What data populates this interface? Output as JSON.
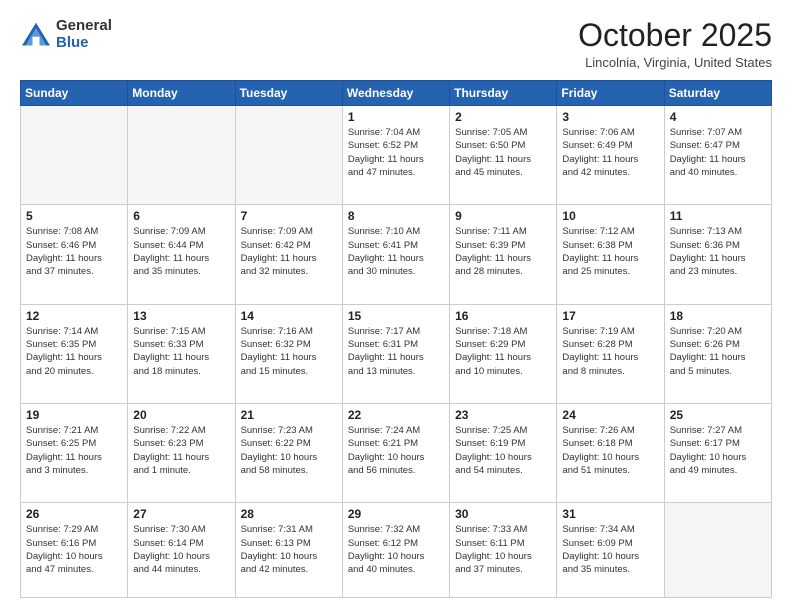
{
  "header": {
    "logo": {
      "general": "General",
      "blue": "Blue"
    },
    "title": "October 2025",
    "location": "Lincolnia, Virginia, United States"
  },
  "weekdays": [
    "Sunday",
    "Monday",
    "Tuesday",
    "Wednesday",
    "Thursday",
    "Friday",
    "Saturday"
  ],
  "weeks": [
    [
      {
        "day": "",
        "empty": true
      },
      {
        "day": "",
        "empty": true
      },
      {
        "day": "",
        "empty": true
      },
      {
        "day": "1",
        "info": "Sunrise: 7:04 AM\nSunset: 6:52 PM\nDaylight: 11 hours\nand 47 minutes."
      },
      {
        "day": "2",
        "info": "Sunrise: 7:05 AM\nSunset: 6:50 PM\nDaylight: 11 hours\nand 45 minutes."
      },
      {
        "day": "3",
        "info": "Sunrise: 7:06 AM\nSunset: 6:49 PM\nDaylight: 11 hours\nand 42 minutes."
      },
      {
        "day": "4",
        "info": "Sunrise: 7:07 AM\nSunset: 6:47 PM\nDaylight: 11 hours\nand 40 minutes."
      }
    ],
    [
      {
        "day": "5",
        "info": "Sunrise: 7:08 AM\nSunset: 6:46 PM\nDaylight: 11 hours\nand 37 minutes."
      },
      {
        "day": "6",
        "info": "Sunrise: 7:09 AM\nSunset: 6:44 PM\nDaylight: 11 hours\nand 35 minutes."
      },
      {
        "day": "7",
        "info": "Sunrise: 7:09 AM\nSunset: 6:42 PM\nDaylight: 11 hours\nand 32 minutes."
      },
      {
        "day": "8",
        "info": "Sunrise: 7:10 AM\nSunset: 6:41 PM\nDaylight: 11 hours\nand 30 minutes."
      },
      {
        "day": "9",
        "info": "Sunrise: 7:11 AM\nSunset: 6:39 PM\nDaylight: 11 hours\nand 28 minutes."
      },
      {
        "day": "10",
        "info": "Sunrise: 7:12 AM\nSunset: 6:38 PM\nDaylight: 11 hours\nand 25 minutes."
      },
      {
        "day": "11",
        "info": "Sunrise: 7:13 AM\nSunset: 6:36 PM\nDaylight: 11 hours\nand 23 minutes."
      }
    ],
    [
      {
        "day": "12",
        "info": "Sunrise: 7:14 AM\nSunset: 6:35 PM\nDaylight: 11 hours\nand 20 minutes."
      },
      {
        "day": "13",
        "info": "Sunrise: 7:15 AM\nSunset: 6:33 PM\nDaylight: 11 hours\nand 18 minutes."
      },
      {
        "day": "14",
        "info": "Sunrise: 7:16 AM\nSunset: 6:32 PM\nDaylight: 11 hours\nand 15 minutes."
      },
      {
        "day": "15",
        "info": "Sunrise: 7:17 AM\nSunset: 6:31 PM\nDaylight: 11 hours\nand 13 minutes."
      },
      {
        "day": "16",
        "info": "Sunrise: 7:18 AM\nSunset: 6:29 PM\nDaylight: 11 hours\nand 10 minutes."
      },
      {
        "day": "17",
        "info": "Sunrise: 7:19 AM\nSunset: 6:28 PM\nDaylight: 11 hours\nand 8 minutes."
      },
      {
        "day": "18",
        "info": "Sunrise: 7:20 AM\nSunset: 6:26 PM\nDaylight: 11 hours\nand 5 minutes."
      }
    ],
    [
      {
        "day": "19",
        "info": "Sunrise: 7:21 AM\nSunset: 6:25 PM\nDaylight: 11 hours\nand 3 minutes."
      },
      {
        "day": "20",
        "info": "Sunrise: 7:22 AM\nSunset: 6:23 PM\nDaylight: 11 hours\nand 1 minute."
      },
      {
        "day": "21",
        "info": "Sunrise: 7:23 AM\nSunset: 6:22 PM\nDaylight: 10 hours\nand 58 minutes."
      },
      {
        "day": "22",
        "info": "Sunrise: 7:24 AM\nSunset: 6:21 PM\nDaylight: 10 hours\nand 56 minutes."
      },
      {
        "day": "23",
        "info": "Sunrise: 7:25 AM\nSunset: 6:19 PM\nDaylight: 10 hours\nand 54 minutes."
      },
      {
        "day": "24",
        "info": "Sunrise: 7:26 AM\nSunset: 6:18 PM\nDaylight: 10 hours\nand 51 minutes."
      },
      {
        "day": "25",
        "info": "Sunrise: 7:27 AM\nSunset: 6:17 PM\nDaylight: 10 hours\nand 49 minutes."
      }
    ],
    [
      {
        "day": "26",
        "info": "Sunrise: 7:29 AM\nSunset: 6:16 PM\nDaylight: 10 hours\nand 47 minutes."
      },
      {
        "day": "27",
        "info": "Sunrise: 7:30 AM\nSunset: 6:14 PM\nDaylight: 10 hours\nand 44 minutes."
      },
      {
        "day": "28",
        "info": "Sunrise: 7:31 AM\nSunset: 6:13 PM\nDaylight: 10 hours\nand 42 minutes."
      },
      {
        "day": "29",
        "info": "Sunrise: 7:32 AM\nSunset: 6:12 PM\nDaylight: 10 hours\nand 40 minutes."
      },
      {
        "day": "30",
        "info": "Sunrise: 7:33 AM\nSunset: 6:11 PM\nDaylight: 10 hours\nand 37 minutes."
      },
      {
        "day": "31",
        "info": "Sunrise: 7:34 AM\nSunset: 6:09 PM\nDaylight: 10 hours\nand 35 minutes."
      },
      {
        "day": "",
        "empty": true
      }
    ]
  ]
}
